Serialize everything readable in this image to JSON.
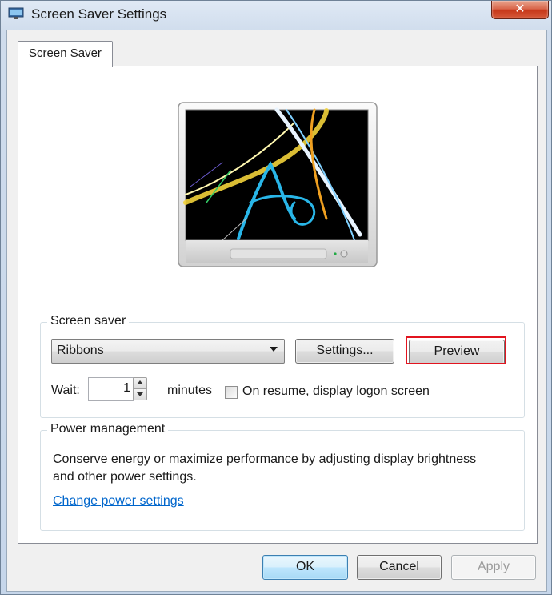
{
  "window": {
    "title": "Screen Saver Settings",
    "close_label": "✕"
  },
  "tabs": [
    {
      "label": "Screen Saver"
    }
  ],
  "screen_saver": {
    "legend": "Screen saver",
    "selected": "Ribbons",
    "settings_label": "Settings...",
    "preview_label": "Preview",
    "wait_label": "Wait:",
    "wait_value": "1",
    "minutes_label": "minutes",
    "resume_label": "On resume, display logon screen",
    "resume_checked": false
  },
  "power": {
    "legend": "Power management",
    "description": "Conserve energy or maximize performance by adjusting display brightness and other power settings.",
    "link": "Change power settings"
  },
  "footer": {
    "ok_label": "OK",
    "cancel_label": "Cancel",
    "apply_label": "Apply"
  },
  "colors": {
    "highlight": "#e2141f",
    "link": "#0066cc",
    "ribbon_yellow": "#f2d23a",
    "ribbon_blue": "#29b6e8",
    "ribbon_white": "#e8f4ff",
    "ribbon_orange": "#f0a020"
  }
}
